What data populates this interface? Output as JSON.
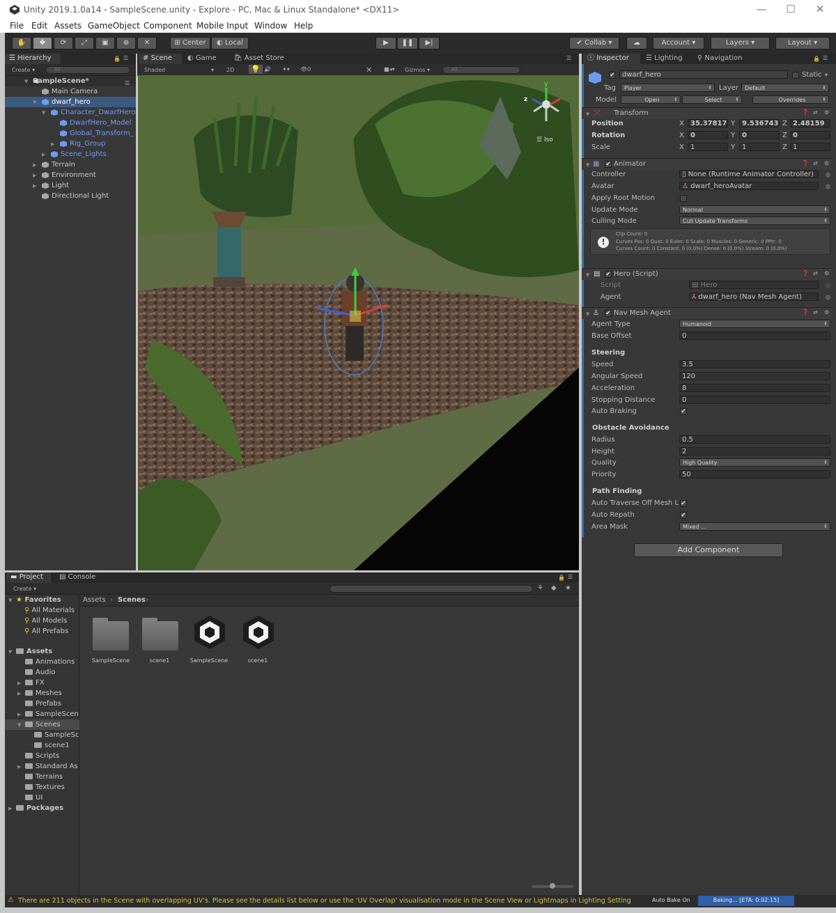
{
  "window": {
    "title": "Unity 2019.1.0a14 - SampleScene.unity - Explore - PC, Mac & Linux Standalone* <DX11>",
    "minimize": "—",
    "maximize": "☐",
    "close": "✕"
  },
  "menu": [
    "File",
    "Edit",
    "Assets",
    "GameObject",
    "Component",
    "Mobile Input",
    "Window",
    "Help"
  ],
  "toolbar": {
    "tools": [
      "hand-tool-icon",
      "move-tool-icon",
      "rotate-tool-icon",
      "scale-tool-icon",
      "rect-tool-icon",
      "transform-tool-icon",
      "custom-tool-icon"
    ],
    "pivot": "Center",
    "pivot_space": "Local",
    "play": "▶",
    "pause": "❚❚",
    "step": "▶|",
    "collab": "Collab",
    "account": "Account",
    "layers": "Layers",
    "layout": "Layout"
  },
  "hierarchy": {
    "tab": "Hierarchy",
    "create": "Create",
    "search_placeholder": "All",
    "scene": "SampleScene*",
    "items": [
      "Main Camera",
      "dwarf_hero",
      "Character_DwarfHero",
      "DwarfHero_Model",
      "Global_Transform_",
      "Rig_Group",
      "Scene_Lights",
      "Terrain",
      "Environment",
      "Light",
      "Directional Light"
    ]
  },
  "scene_view": {
    "tabs": [
      "Scene",
      "Game",
      "Asset Store"
    ],
    "shading": "Shaded",
    "mode_2d": "2D",
    "effects_count": "0",
    "gizmos": "Gizmos",
    "search_placeholder": "All",
    "projection": "Iso",
    "axis_y": "y",
    "axis_z": "z"
  },
  "inspector": {
    "tabs": [
      "Inspector",
      "Lighting",
      "Navigation"
    ],
    "object_name": "dwarf_hero",
    "static_label": "Static",
    "tag_label": "Tag",
    "tag_value": "Player",
    "layer_label": "Layer",
    "layer_value": "Default",
    "model_label": "Model",
    "model_buttons": [
      "Open",
      "Select",
      "Overrides"
    ],
    "transform": {
      "title": "Transform",
      "rows": [
        {
          "label": "Position",
          "x": "35.37817",
          "y": "9.536743e",
          "z": "2.48159"
        },
        {
          "label": "Rotation",
          "x": "0",
          "y": "0",
          "z": "0"
        },
        {
          "label": "Scale",
          "x": "1",
          "y": "1",
          "z": "1"
        }
      ]
    },
    "animator": {
      "title": "Animator",
      "controller_label": "Controller",
      "controller_value": "None (Runtime Animator Controller)",
      "avatar_label": "Avatar",
      "avatar_value": "dwarf_heroAvatar",
      "root_motion_label": "Apply Root Motion",
      "update_mode_label": "Update Mode",
      "update_mode_value": "Normal",
      "culling_mode_label": "Culling Mode",
      "culling_mode_value": "Cull Update Transforms",
      "info_line1": "Clip Count: 0",
      "info_line2": "Curves Pos: 0 Quat: 0 Euler: 0 Scale: 0 Muscles: 0 Generic: 0 PPtr: 0",
      "info_line3": "Curves Count: 0 Constant: 0 (0.0%) Dense: 0 (0.0%) Stream: 0 (0.0%)"
    },
    "hero_script": {
      "title": "Hero (Script)",
      "script_label": "Script",
      "script_value": "Hero",
      "agent_label": "Agent",
      "agent_value": "dwarf_hero (Nav Mesh Agent)"
    },
    "nav_mesh_agent": {
      "title": "Nav Mesh Agent",
      "agent_type_label": "Agent Type",
      "agent_type_value": "Humanoid",
      "base_offset_label": "Base Offset",
      "base_offset_value": "0",
      "steering_header": "Steering",
      "speed_label": "Speed",
      "speed_value": "3.5",
      "angular_speed_label": "Angular Speed",
      "angular_speed_value": "120",
      "acceleration_label": "Acceleration",
      "acceleration_value": "8",
      "stopping_distance_label": "Stopping Distance",
      "stopping_distance_value": "0",
      "auto_braking_label": "Auto Braking",
      "obstacle_header": "Obstacle Avoidance",
      "radius_label": "Radius",
      "radius_value": "0.5",
      "height_label": "Height",
      "height_value": "2",
      "quality_label": "Quality",
      "quality_value": "High Quality",
      "priority_label": "Priority",
      "priority_value": "50",
      "pathfinding_header": "Path Finding",
      "auto_traverse_label": "Auto Traverse Off Mesh L",
      "auto_repath_label": "Auto Repath",
      "area_mask_label": "Area Mask",
      "area_mask_value": "Mixed ..."
    },
    "add_component": "Add Component"
  },
  "project": {
    "tabs": [
      "Project",
      "Console"
    ],
    "create": "Create",
    "favorites_header": "Favorites",
    "favorites": [
      "All Materials",
      "All Models",
      "All Prefabs"
    ],
    "assets_header": "Assets",
    "folders": [
      "Animations",
      "Audio",
      "FX",
      "Meshes",
      "Prefabs",
      "SampleScen",
      "Scenes",
      "SampleSc",
      "scene1",
      "Scripts",
      "Standard As",
      "Terrains",
      "Textures",
      "UI"
    ],
    "packages_header": "Packages",
    "breadcrumb": [
      "Assets",
      "Scenes"
    ],
    "assets": [
      "SampleScene",
      "scene1",
      "SampleScene",
      "scene1"
    ]
  },
  "status": {
    "message": "There are 211 objects in the Scene with overlapping UV's. Please see the details list below or use the 'UV Overlap' visualisation mode in the Scene View or Lightmaps in Lighting Setting",
    "auto_bake": "Auto Bake On",
    "baking": "Baking... [ETA: 0:02:15]"
  },
  "colors": {
    "accent": "#3c5a80",
    "link_blue": "#6e9cff",
    "warning": "#d8c045"
  }
}
